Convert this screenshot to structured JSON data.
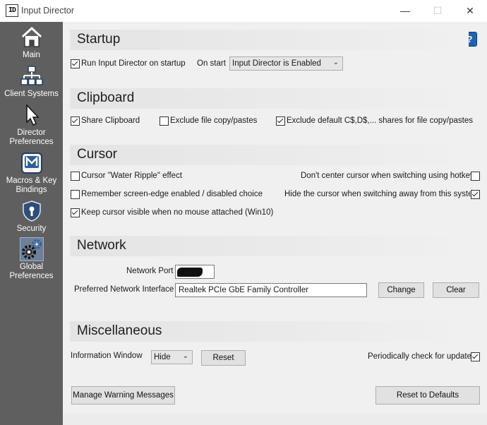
{
  "window": {
    "title": "Input Director",
    "app_icon_text": "ID",
    "minimize": "—",
    "maximize": "☐",
    "close": "✕"
  },
  "sidebar": {
    "items": [
      {
        "label": "Main",
        "icon": "home-icon"
      },
      {
        "label": "Client Systems",
        "icon": "network-icon"
      },
      {
        "label": "Director Preferences",
        "icon": "pointer-icon"
      },
      {
        "label": "Macros & Key Bindings",
        "icon": "macro-icon"
      },
      {
        "label": "Security",
        "icon": "shield-icon"
      },
      {
        "label": "Global Preferences",
        "icon": "gears-icon",
        "active": true
      }
    ]
  },
  "help": {
    "label": "?"
  },
  "startup": {
    "title": "Startup",
    "run_on_startup": {
      "label": "Run Input Director on startup",
      "checked": true
    },
    "on_start_label": "On start",
    "on_start_value": "Input Director is Enabled"
  },
  "clipboard": {
    "title": "Clipboard",
    "share": {
      "label": "Share Clipboard",
      "checked": true
    },
    "exclude_file": {
      "label": "Exclude file copy/pastes",
      "checked": false
    },
    "exclude_default": {
      "label": "Exclude default C$,D$,... shares for file copy/pastes",
      "checked": true
    }
  },
  "cursor": {
    "title": "Cursor",
    "water_ripple": {
      "label": "Cursor \"Water Ripple\" effect",
      "checked": false
    },
    "dont_center": {
      "label": "Don't center cursor when switching using hotkeys",
      "checked": false
    },
    "remember_edge": {
      "label": "Remember screen-edge enabled / disabled choice",
      "checked": false
    },
    "hide_cursor": {
      "label": "Hide the cursor when switching away from this system",
      "checked": true
    },
    "keep_visible": {
      "label": "Keep cursor visible when no mouse attached (Win10)",
      "checked": true
    }
  },
  "network": {
    "title": "Network",
    "port_label": "Network Port",
    "interface_label": "Preferred Network Interface",
    "interface_value": "Realtek PCIe GbE Family Controller",
    "change_label": "Change",
    "clear_label": "Clear"
  },
  "misc": {
    "title": "Miscellaneous",
    "info_window_label": "Information Window",
    "info_window_value": "Hide",
    "reset_label": "Reset",
    "check_updates": {
      "label": "Periodically check for updates",
      "checked": true
    }
  },
  "footer": {
    "manage_warnings_label": "Manage Warning Messages",
    "reset_defaults_label": "Reset to Defaults"
  },
  "colors": {
    "sidebar_bg": "#5f5f5f",
    "help_blue": "#1f64b4",
    "content_bg": "#f0f0f0"
  }
}
